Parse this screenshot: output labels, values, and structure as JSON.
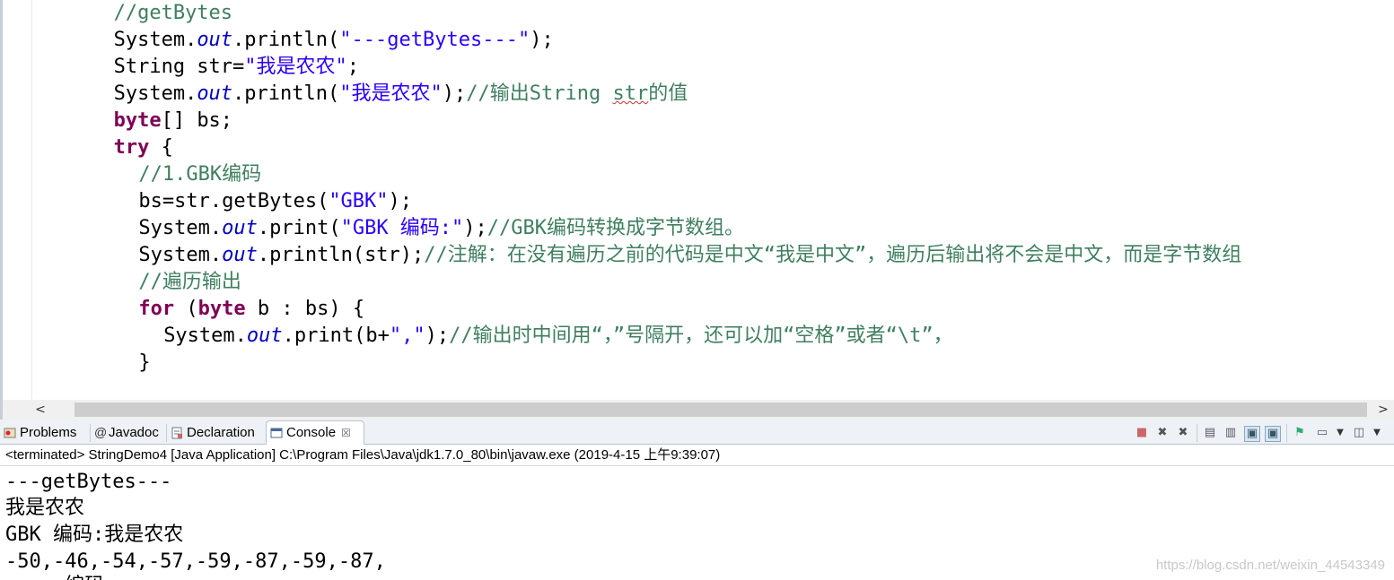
{
  "editor": {
    "lines": [
      {
        "indent": 4,
        "segments": [
          {
            "t": "//getBytes",
            "c": "cm"
          }
        ]
      },
      {
        "indent": 4,
        "segments": [
          {
            "t": "System.",
            "c": ""
          },
          {
            "t": "out",
            "c": "fi"
          },
          {
            "t": ".println(",
            "c": ""
          },
          {
            "t": "\"---getBytes---\"",
            "c": "st"
          },
          {
            "t": ");",
            "c": ""
          }
        ]
      },
      {
        "indent": 4,
        "segments": [
          {
            "t": "String str=",
            "c": ""
          },
          {
            "t": "\"我是农农\"",
            "c": "st"
          },
          {
            "t": ";",
            "c": ""
          }
        ]
      },
      {
        "indent": 4,
        "segments": [
          {
            "t": "System.",
            "c": ""
          },
          {
            "t": "out",
            "c": "fi"
          },
          {
            "t": ".println(",
            "c": ""
          },
          {
            "t": "\"我是农农\"",
            "c": "st"
          },
          {
            "t": ");",
            "c": ""
          },
          {
            "t": "//输出String ",
            "c": "cm"
          },
          {
            "t": "str",
            "c": "cm sq"
          },
          {
            "t": "的值",
            "c": "cm"
          }
        ]
      },
      {
        "indent": 4,
        "segments": [
          {
            "t": "byte",
            "c": "kw"
          },
          {
            "t": "[] bs;",
            "c": ""
          }
        ]
      },
      {
        "indent": 4,
        "segments": [
          {
            "t": "try",
            "c": "kw"
          },
          {
            "t": " {",
            "c": ""
          }
        ]
      },
      {
        "indent": 6,
        "segments": [
          {
            "t": "//1.GBK编码",
            "c": "cm"
          }
        ]
      },
      {
        "indent": 6,
        "segments": [
          {
            "t": "bs=str.getBytes(",
            "c": ""
          },
          {
            "t": "\"GBK\"",
            "c": "st"
          },
          {
            "t": ");",
            "c": ""
          }
        ]
      },
      {
        "indent": 6,
        "segments": [
          {
            "t": "System.",
            "c": ""
          },
          {
            "t": "out",
            "c": "fi"
          },
          {
            "t": ".print(",
            "c": ""
          },
          {
            "t": "\"GBK 编码:\"",
            "c": "st"
          },
          {
            "t": ");",
            "c": ""
          },
          {
            "t": "//GBK编码转换成字节数组。",
            "c": "cm"
          }
        ]
      },
      {
        "indent": 6,
        "segments": [
          {
            "t": "System.",
            "c": ""
          },
          {
            "t": "out",
            "c": "fi"
          },
          {
            "t": ".println(str);",
            "c": ""
          },
          {
            "t": "//注解：在没有遍历之前的代码是中文“我是中文”，遍历后输出将不会是中文，而是字节数组",
            "c": "cm"
          }
        ]
      },
      {
        "indent": 6,
        "segments": [
          {
            "t": "//遍历输出",
            "c": "cm"
          }
        ]
      },
      {
        "indent": 6,
        "segments": [
          {
            "t": "for",
            "c": "kw"
          },
          {
            "t": " (",
            "c": ""
          },
          {
            "t": "byte",
            "c": "kw"
          },
          {
            "t": " b : bs) {",
            "c": ""
          }
        ]
      },
      {
        "indent": 8,
        "segments": [
          {
            "t": "System.",
            "c": ""
          },
          {
            "t": "out",
            "c": "fi"
          },
          {
            "t": ".print(b+",
            "c": ""
          },
          {
            "t": "\",\"",
            "c": "st"
          },
          {
            "t": ");",
            "c": ""
          },
          {
            "t": "//输出时中间用“，”号隔开，还可以加“空格”或者“\\t”，",
            "c": "cm"
          }
        ]
      },
      {
        "indent": 6,
        "segments": [
          {
            "t": "}",
            "c": ""
          }
        ]
      }
    ]
  },
  "scrollbar": {
    "left_arrow": "<",
    "right_arrow": ">"
  },
  "tabs": [
    {
      "label": "Problems",
      "icon": "problems-icon",
      "active": false
    },
    {
      "label": "Javadoc",
      "icon": "at-icon",
      "active": false
    },
    {
      "label": "Declaration",
      "icon": "declaration-icon",
      "active": false
    },
    {
      "label": "Console",
      "icon": "console-icon",
      "active": true,
      "close": "☒"
    }
  ],
  "toolbar_icons": [
    "terminate-icon",
    "remove-launch-icon",
    "remove-all-terminated-icon",
    "scroll-lock-icon",
    "word-wrap-icon",
    "show-on-stdout-icon",
    "show-on-stderr-icon",
    "pin-console-icon",
    "display-console-icon",
    "open-console-icon",
    "view-menu-icon"
  ],
  "status": "<terminated> StringDemo4 [Java Application] C:\\Program Files\\Java\\jdk1.7.0_80\\bin\\javaw.exe (2019-4-15 上午9:39:07)",
  "console_output": [
    "---getBytes---",
    "我是农农",
    "GBK 编码:我是农农",
    "-50,-46,-54,-57,-59,-87,-59,-87,",
    "     编码"
  ],
  "watermark": "https://blog.csdn.net/weixin_44543349",
  "colors": {
    "comment": "#3f7f5f",
    "keyword": "#7f0055",
    "string": "#2a00ff",
    "field": "#0000c0"
  }
}
